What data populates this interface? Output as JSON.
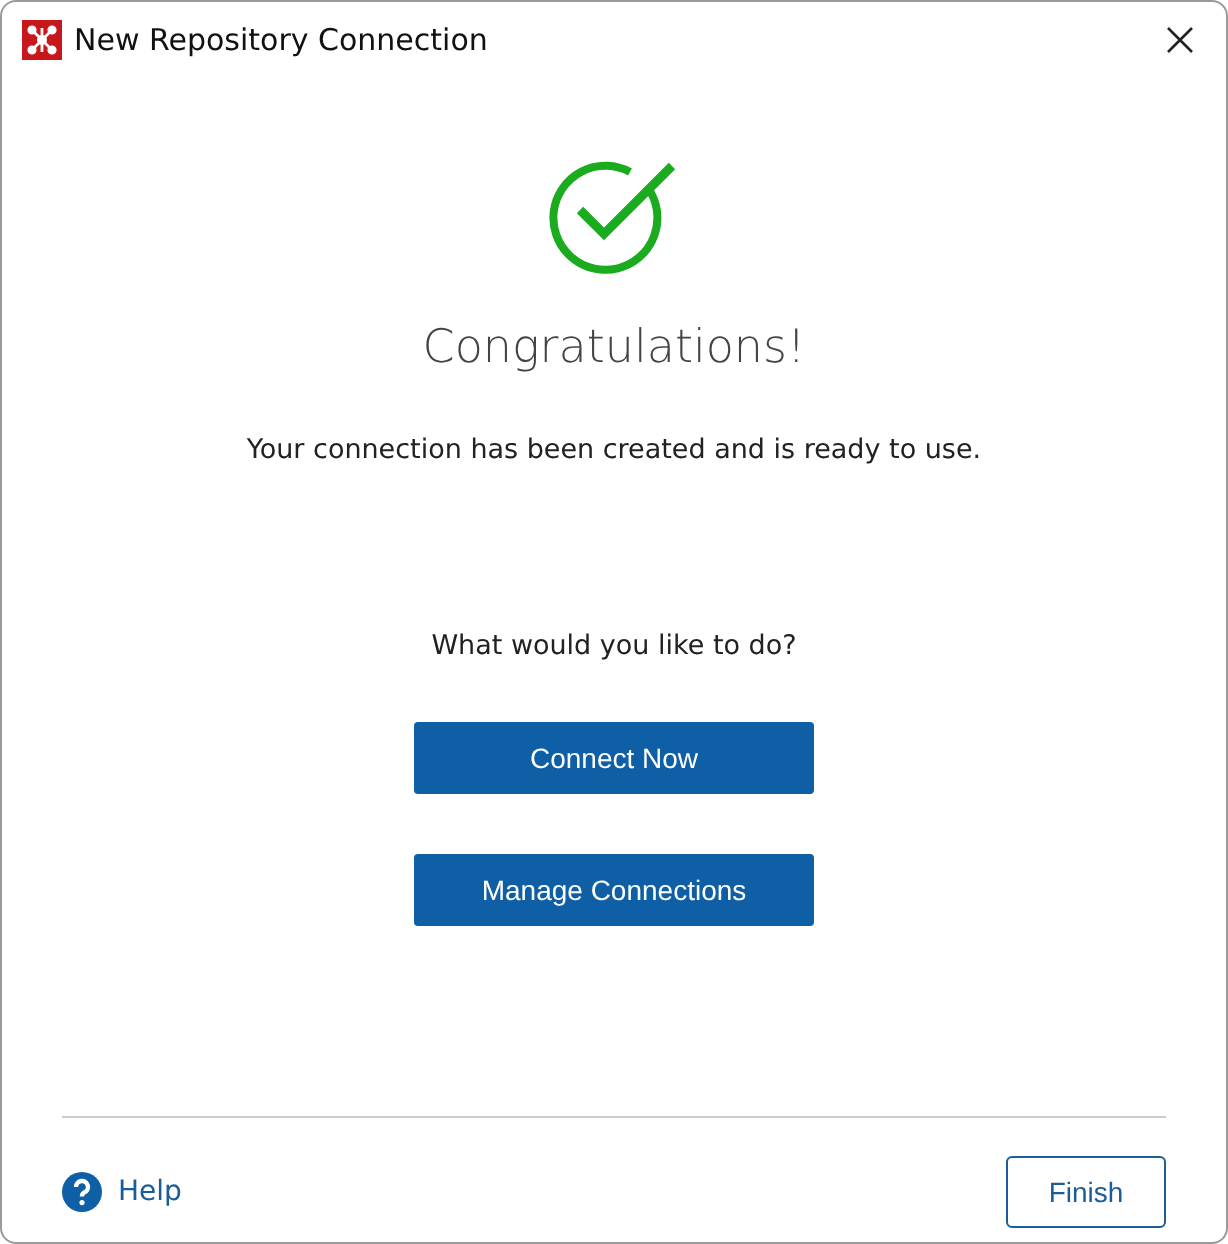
{
  "window": {
    "title": "New Repository Connection"
  },
  "heading": "Congratulations!",
  "message": "Your connection has been created and is ready to use.",
  "question": "What would you like to do?",
  "actions": [
    "Connect Now",
    "Manage Connections"
  ],
  "footer": {
    "help": "Help",
    "finish": "Finish"
  }
}
